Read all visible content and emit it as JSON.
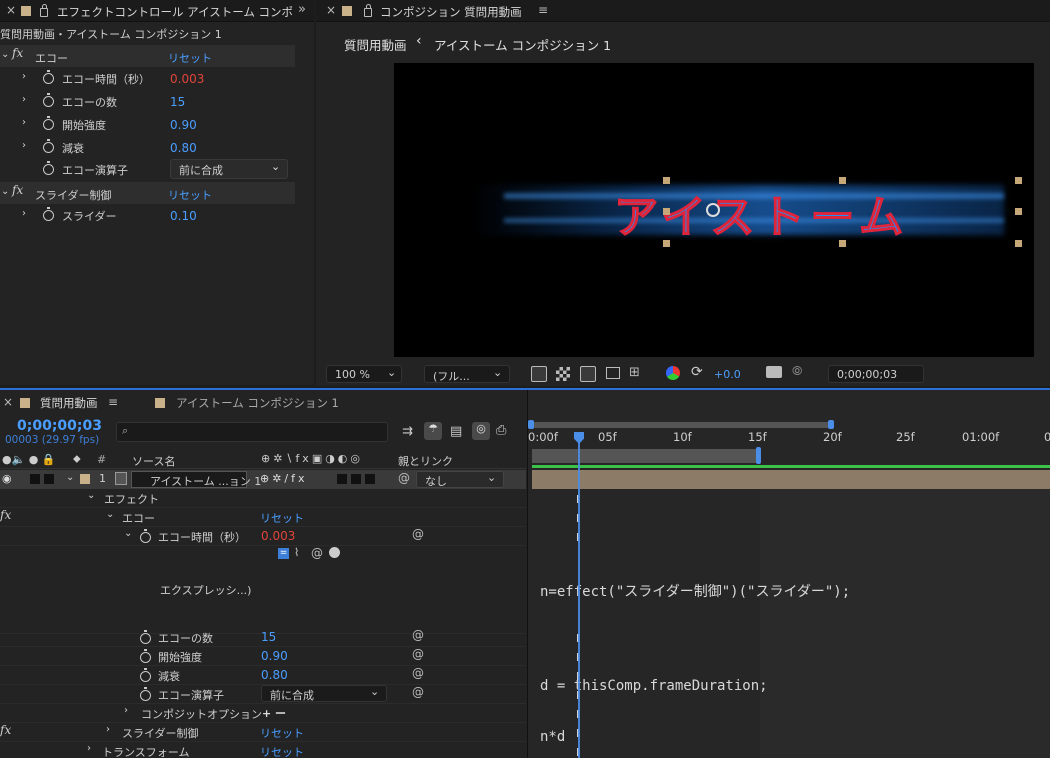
{
  "effect_controls": {
    "tab_title": "エフェクトコントロール アイストーム コンポ",
    "overflow": "»",
    "breadcrumb": "質問用動画・アイストーム コンポジション 1",
    "effects": [
      {
        "name": "エコー",
        "reset": "リセット",
        "params": [
          {
            "label": "エコー時間（秒）",
            "value": "0.003",
            "color": "#e0443a"
          },
          {
            "label": "エコーの数",
            "value": "15",
            "color": "#4a9eff"
          },
          {
            "label": "開始強度",
            "value": "0.90",
            "color": "#4a9eff"
          },
          {
            "label": "減衰",
            "value": "0.80",
            "color": "#4a9eff"
          },
          {
            "label": "エコー演算子",
            "value": "前に合成"
          }
        ]
      },
      {
        "name": "スライダー制御",
        "reset": "リセット",
        "params": [
          {
            "label": "スライダー",
            "value": "0.10",
            "color": "#4a9eff"
          }
        ]
      }
    ]
  },
  "composition": {
    "tab_title": "コンポジション 質問用動画",
    "menu": "≡",
    "nav_parent": "質問用動画",
    "nav_arrow": "‹",
    "nav_current": "アイストーム コンポジション 1",
    "artwork_text": "アイストーム",
    "viewer_toolbar": {
      "zoom": "100 %",
      "resolution": "(フル...",
      "exposure": "+0.0",
      "timecode": "0;00;00;03"
    }
  },
  "timeline": {
    "tab_title": "質問用動画",
    "tab2_title": "アイストーム コンポジション 1",
    "timecode": "0;00;00;03",
    "frame_info": "00003 (29.97 fps)",
    "search_placeholder": "",
    "columns": {
      "hash": "#",
      "source_name": "ソース名",
      "parent": "親とリンク"
    },
    "layer": {
      "number": "1",
      "name": "アイストーム ...ョン 1",
      "parent": "なし"
    },
    "ruler": [
      "0:00f",
      "05f",
      "10f",
      "15f",
      "20f",
      "25f",
      "01:00f",
      "0"
    ],
    "rows": {
      "effects_group": "エフェクト",
      "echo": "エコー",
      "echo_reset": "リセット",
      "echo_time": "エコー時間（秒）",
      "echo_time_value": "0.003",
      "expression_label": "エクスプレッシ...)",
      "echo_count": "エコーの数",
      "echo_count_value": "15",
      "start_intensity": "開始強度",
      "start_intensity_value": "0.90",
      "decay": "減衰",
      "decay_value": "0.80",
      "echo_operator": "エコー演算子",
      "echo_operator_value": "前に合成",
      "composite_options": "コンポジットオプション",
      "composite_symbols": "+ ー",
      "slider_control": "スライダー制御",
      "slider_reset": "リセット",
      "transform": "トランスフォーム",
      "transform_reset": "リセット"
    },
    "expression_lines": [
      "n=effect(\"スライダー制御\")(\"スライダー\");",
      "d = thisComp.frameDuration;",
      "n*d"
    ]
  }
}
